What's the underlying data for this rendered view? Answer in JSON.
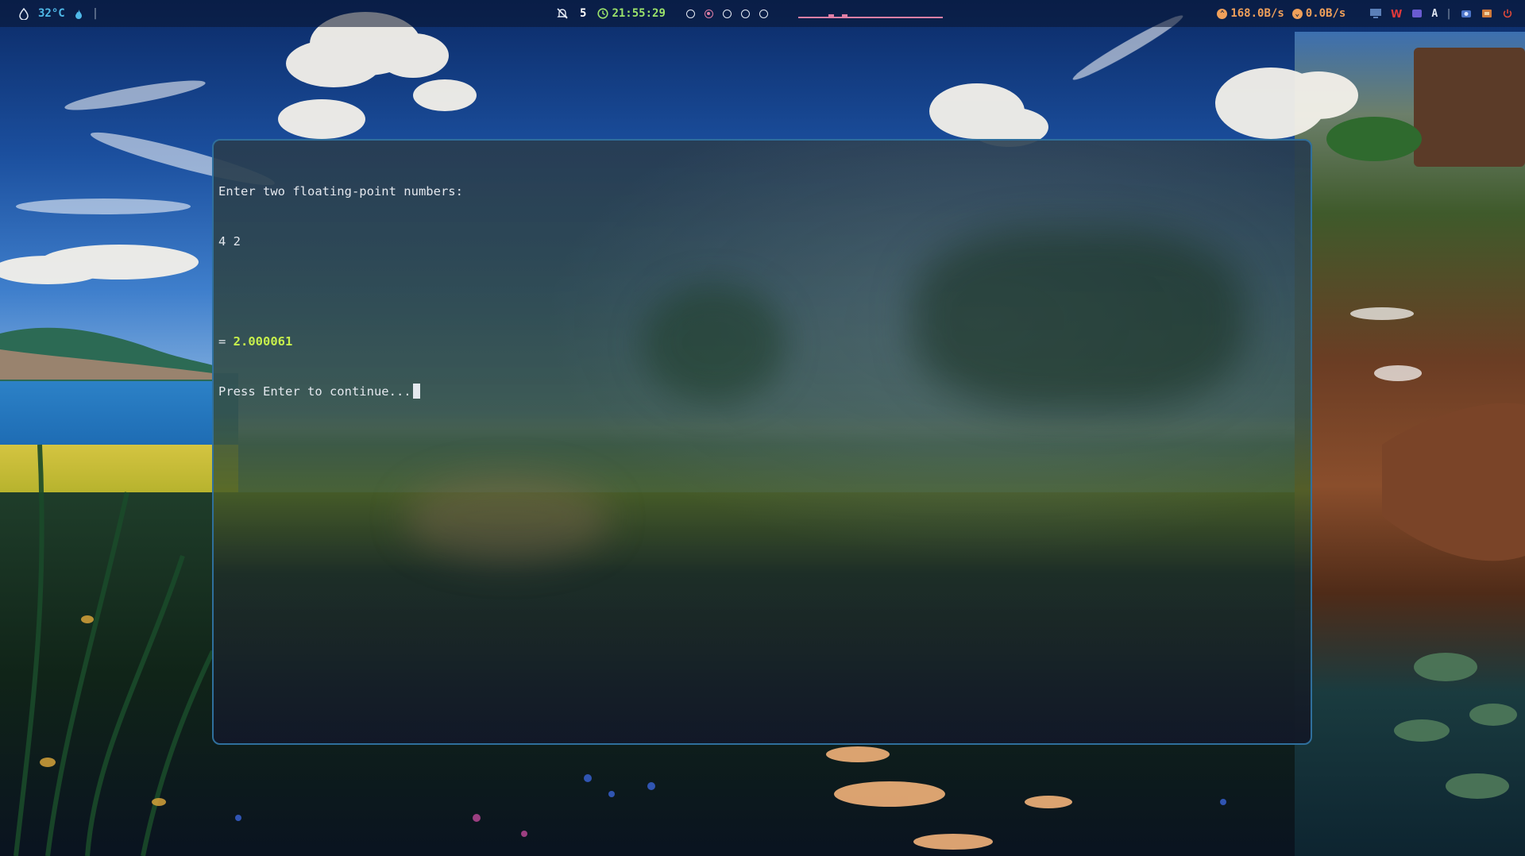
{
  "topbar": {
    "weather_icon": "droplet-icon",
    "temperature": "32°C",
    "dnd_icon": "bell-off-icon",
    "dnd_count": "5",
    "clock_icon": "clock-icon",
    "time": "21:55:29",
    "workspaces": [
      {
        "label": "workspace-1",
        "active": false
      },
      {
        "label": "workspace-2",
        "active": true
      },
      {
        "label": "workspace-3",
        "active": false
      },
      {
        "label": "workspace-4",
        "active": false
      },
      {
        "label": "workspace-5",
        "active": false
      }
    ],
    "net_up": "168.0B/s",
    "net_down": "0.0B/s",
    "tray_letter": "A",
    "colors": {
      "temp": "#4fb9e8",
      "clock": "#9be36b",
      "workspace_active": "#e07fa6",
      "net": "#f0a05a",
      "power": "#e04a3a"
    }
  },
  "terminal": {
    "lines": [
      "Enter two floating-point numbers:",
      "4 2",
      "",
      "= ",
      "Press Enter to continue..."
    ],
    "result_value": "2.000061",
    "text_color": "#e4e8ee",
    "result_color": "#c7f04c"
  }
}
